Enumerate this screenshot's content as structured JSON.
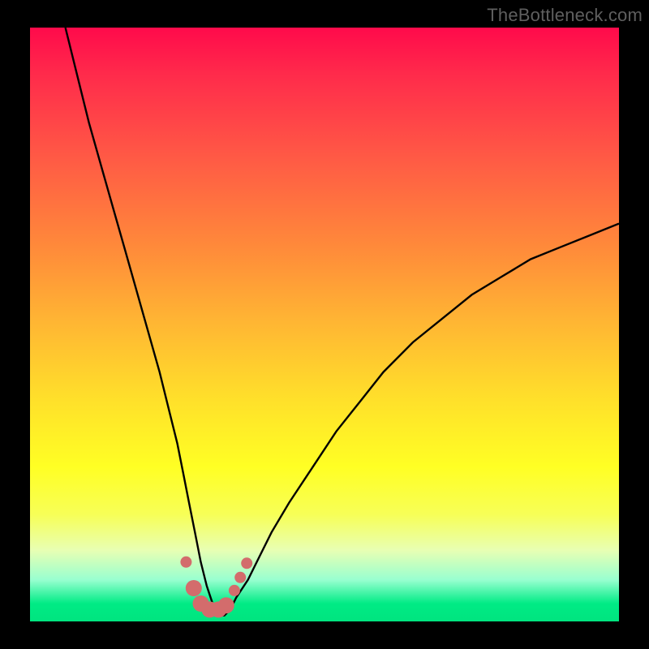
{
  "watermark": "TheBottleneck.com",
  "chart_data": {
    "type": "line",
    "title": "",
    "xlabel": "",
    "ylabel": "",
    "xlim": [
      0,
      100
    ],
    "ylim": [
      0,
      100
    ],
    "grid": false,
    "legend": false,
    "series": [
      {
        "name": "curve",
        "color": "#000000",
        "x": [
          6,
          8,
          10,
          12,
          14,
          16,
          18,
          20,
          22,
          24,
          25,
          26,
          27,
          28,
          29,
          30,
          31,
          32,
          33,
          34,
          35,
          37,
          39,
          41,
          44,
          48,
          52,
          56,
          60,
          65,
          70,
          75,
          80,
          85,
          90,
          95,
          100
        ],
        "values": [
          100,
          92,
          84,
          77,
          70,
          63,
          56,
          49,
          42,
          34,
          30,
          25,
          20,
          15,
          10,
          6,
          3,
          1,
          1,
          2,
          4,
          7,
          11,
          15,
          20,
          26,
          32,
          37,
          42,
          47,
          51,
          55,
          58,
          61,
          63,
          65,
          67
        ]
      }
    ],
    "markers": {
      "color": "#d36c6c",
      "radius_small": 7,
      "radius_large": 10,
      "points": [
        {
          "x": 26.5,
          "y": 10.0,
          "r": 7
        },
        {
          "x": 27.8,
          "y": 5.6,
          "r": 10
        },
        {
          "x": 29.0,
          "y": 3.0,
          "r": 10
        },
        {
          "x": 30.5,
          "y": 2.0,
          "r": 10
        },
        {
          "x": 32.0,
          "y": 2.0,
          "r": 10
        },
        {
          "x": 33.3,
          "y": 2.7,
          "r": 10
        },
        {
          "x": 34.7,
          "y": 5.2,
          "r": 7
        },
        {
          "x": 35.7,
          "y": 7.4,
          "r": 7
        },
        {
          "x": 36.8,
          "y": 9.8,
          "r": 7
        }
      ]
    },
    "background_gradient": {
      "top": "#ff0a4b",
      "mid_upper": "#ff8a3a",
      "mid": "#ffe12a",
      "mid_lower": "#f7ff57",
      "bottom": "#00e47f"
    }
  }
}
